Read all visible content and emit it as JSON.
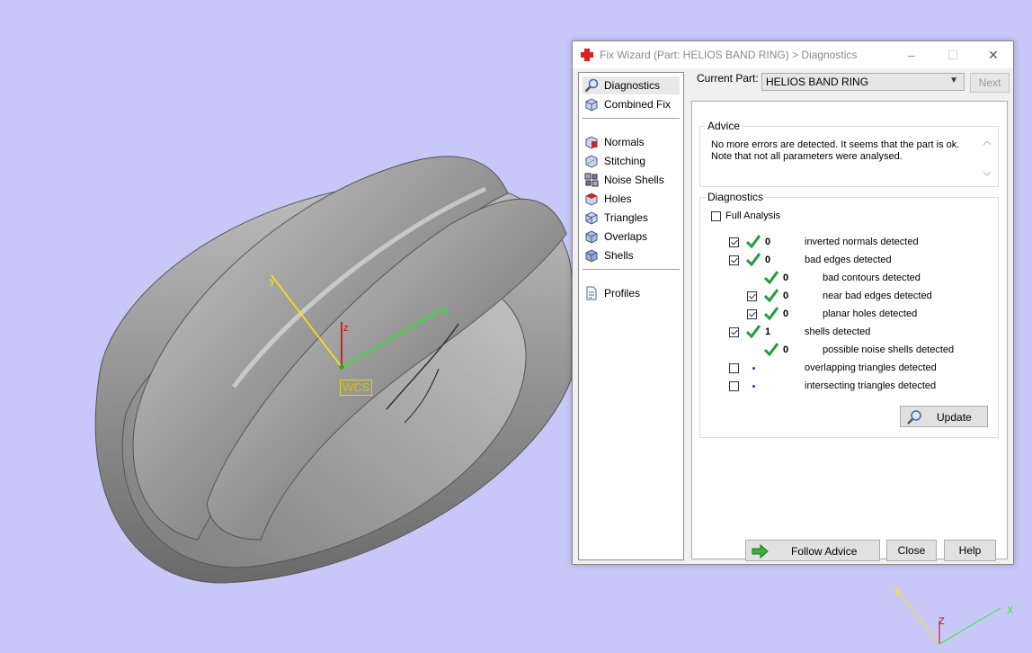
{
  "window": {
    "title": "Fix Wizard (Part: HELIOS BAND RING) > Diagnostics",
    "controls": {
      "minimize": "–",
      "maximize": "☐",
      "close": "✕"
    }
  },
  "viewport": {
    "wcs_label": "WCS",
    "axis_z": "z",
    "axis_x": "x",
    "axis_y": "y",
    "mini_axis_x": "X",
    "mini_axis_z": "Z",
    "mini_axis_y": "X"
  },
  "nav": {
    "items": [
      {
        "label": "Diagnostics",
        "icon": "magnifier-icon",
        "selected": true
      },
      {
        "label": "Combined Fix",
        "icon": "cube-icon"
      },
      {
        "label": "Normals",
        "icon": "normals-cube-icon"
      },
      {
        "label": "Stitching",
        "icon": "stitching-cube-icon"
      },
      {
        "label": "Noise Shells",
        "icon": "noise-shells-icon"
      },
      {
        "label": "Holes",
        "icon": "holes-cube-icon"
      },
      {
        "label": "Triangles",
        "icon": "triangles-cube-icon"
      },
      {
        "label": "Overlaps",
        "icon": "overlaps-cube-icon"
      },
      {
        "label": "Shells",
        "icon": "shells-cube-icon"
      },
      {
        "label": "Profiles",
        "icon": "document-icon"
      }
    ]
  },
  "current_part": {
    "label": "Current Part:",
    "value": "HELIOS BAND RING"
  },
  "next_button": "Next",
  "advice": {
    "title": "Advice",
    "line1": "No more errors are detected. It seems that the part is ok.",
    "line2": "Note that not all parameters were analysed."
  },
  "diagnostics": {
    "title": "Diagnostics",
    "full_analysis": "Full Analysis",
    "rows": [
      {
        "checked": true,
        "status": "ok",
        "count": "0",
        "label": "inverted normals detected"
      },
      {
        "checked": true,
        "status": "ok",
        "count": "0",
        "label": "bad edges detected"
      },
      {
        "checked": null,
        "status": "ok",
        "count": "0",
        "label": "bad contours detected"
      },
      {
        "checked": true,
        "status": "ok",
        "count": "0",
        "label": "near bad edges detected"
      },
      {
        "checked": true,
        "status": "ok",
        "count": "0",
        "label": "planar holes detected"
      },
      {
        "checked": true,
        "status": "ok",
        "count": "1",
        "label": "shells detected"
      },
      {
        "checked": null,
        "status": "ok",
        "count": "0",
        "label": "possible noise shells detected"
      },
      {
        "checked": false,
        "status": "dot",
        "count": "",
        "label": "overlapping triangles detected"
      },
      {
        "checked": false,
        "status": "dot",
        "count": "",
        "label": "intersecting triangles detected"
      }
    ],
    "update_button": "Update"
  },
  "footer": {
    "follow_advice": "Follow Advice",
    "close": "Close",
    "help": "Help"
  },
  "colors": {
    "viewport_bg": "#c8c8f8",
    "check_green": "#1f9e3a",
    "accent_red": "#e02020"
  }
}
